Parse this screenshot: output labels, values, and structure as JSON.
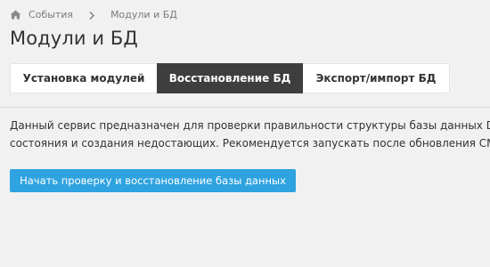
{
  "breadcrumb": {
    "home_icon": "home-icon",
    "items": [
      {
        "label": "События"
      },
      {
        "label": "Модули и БД"
      }
    ],
    "separator_icon": "chevron-right-icon"
  },
  "page": {
    "title": "Модули и БД"
  },
  "tabs": [
    {
      "label": "Установка модулей",
      "active": false
    },
    {
      "label": "Восстановление БД",
      "active": true
    },
    {
      "label": "Экспорт/импорт БД",
      "active": false
    }
  ],
  "main": {
    "description_lines": [
      "Данный сервис предназначен для проверки правильности структуры базы данных DIAF",
      "состояния и создания недостающих. Рекомендуется запускать после обновления CMS с"
    ],
    "start_button_label": "Начать проверку и восстановление базы данных"
  },
  "colors": {
    "background": "#f2f1f1",
    "active_tab": "#3e3e3e",
    "primary_button": "#2ea3e0"
  }
}
